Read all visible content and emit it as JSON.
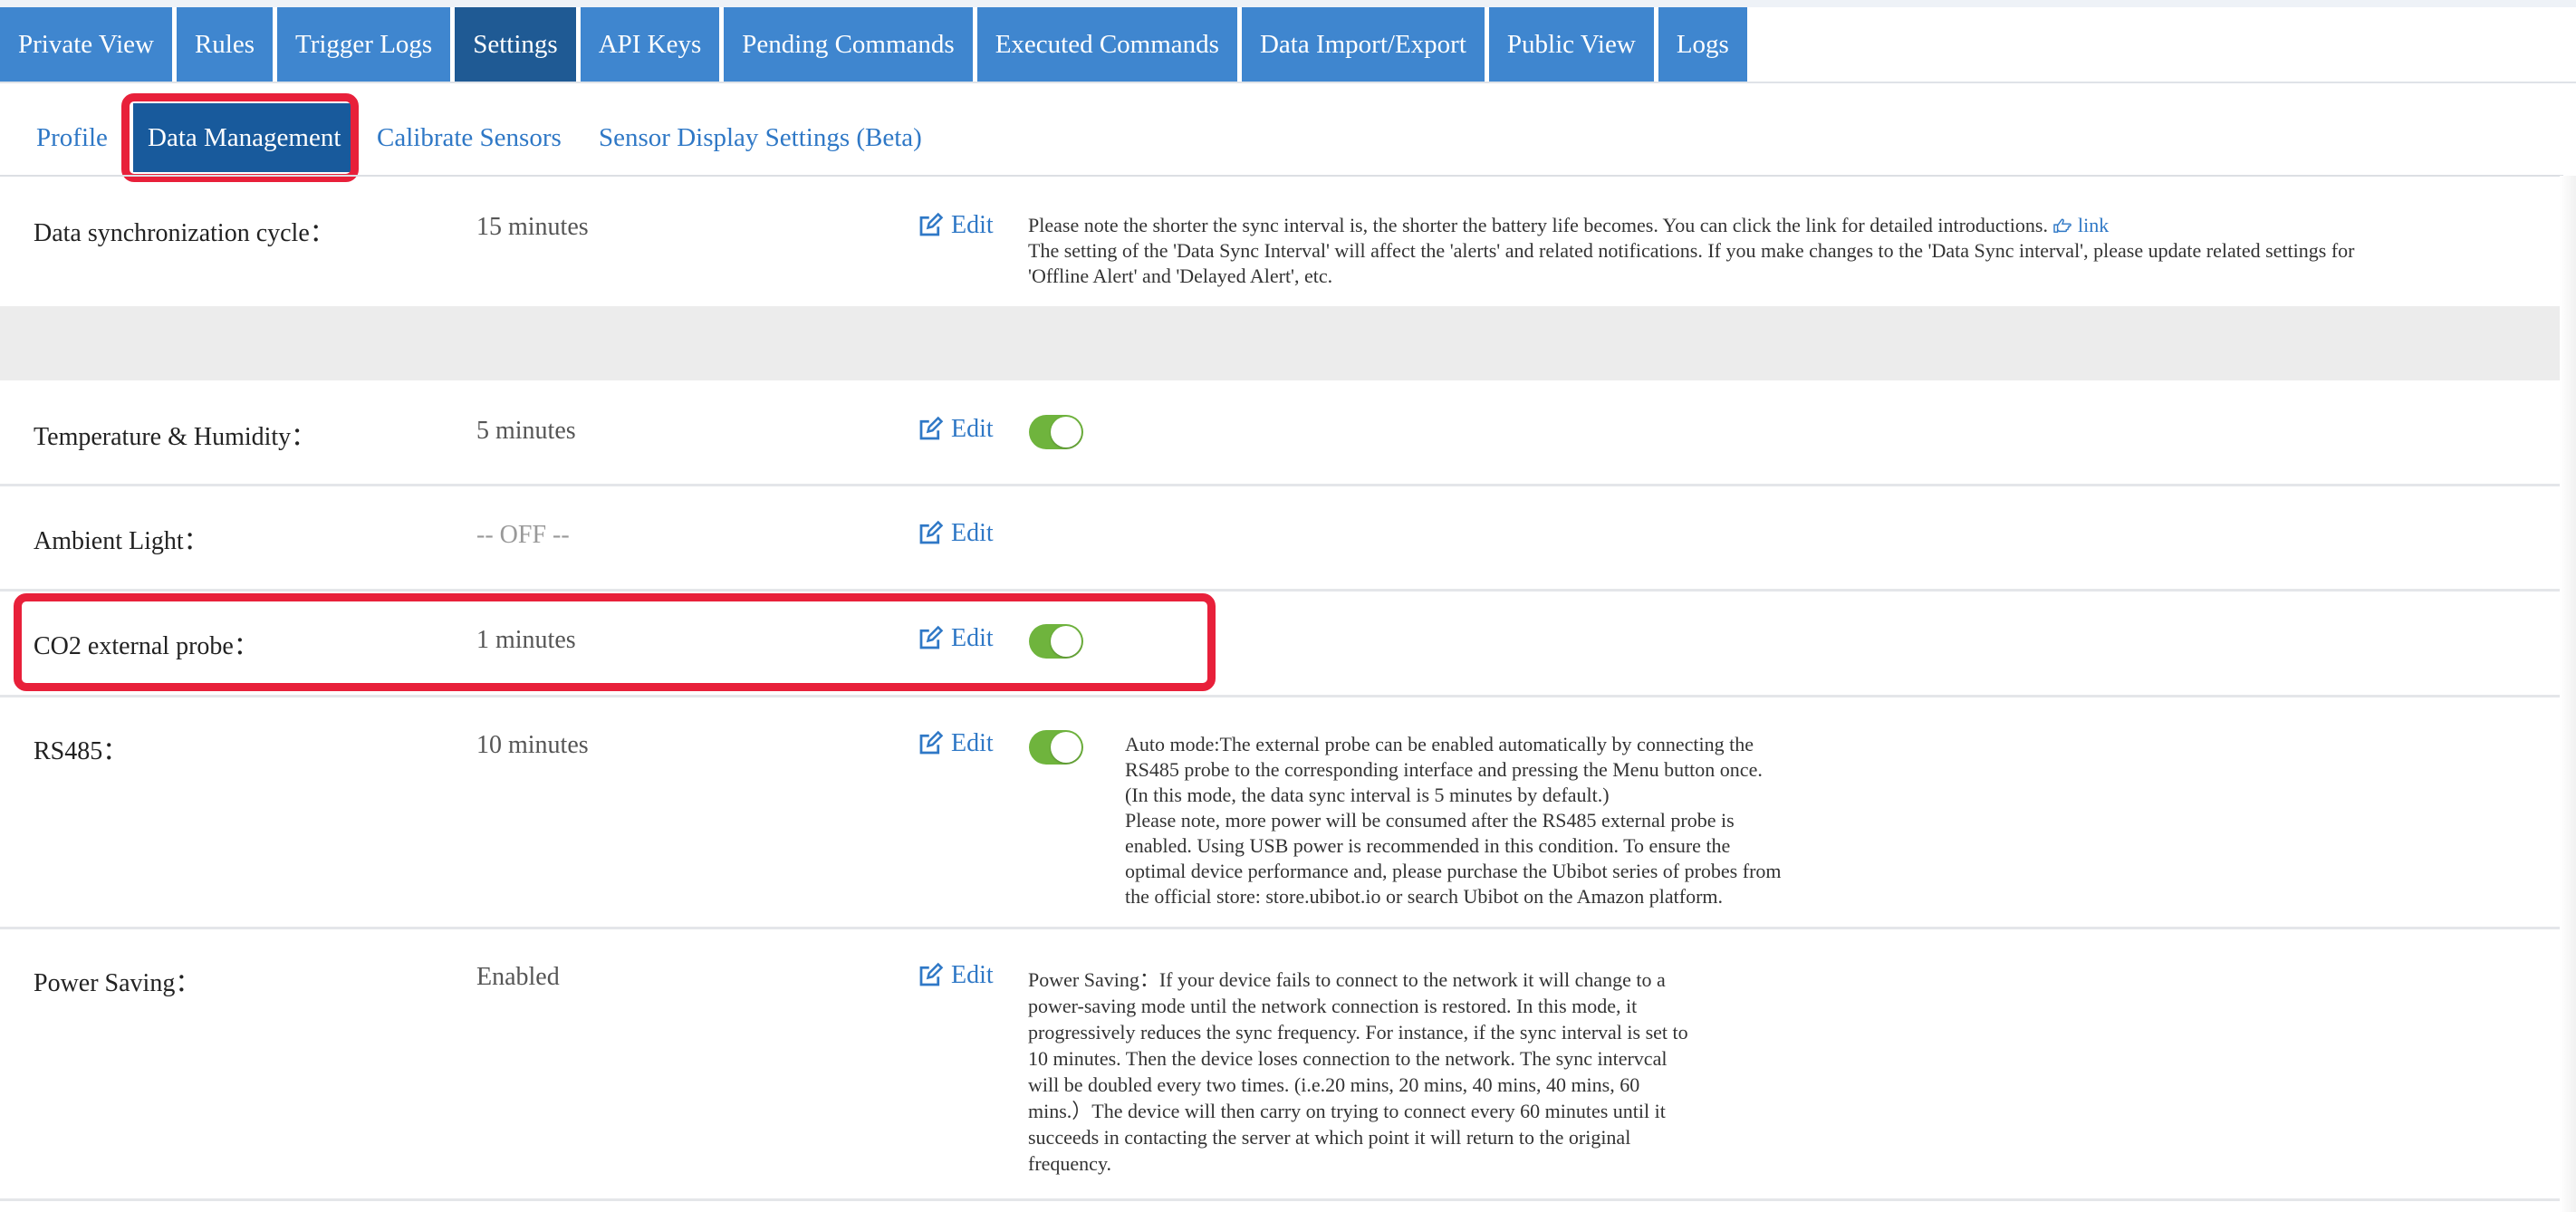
{
  "topnav": {
    "tabs": [
      {
        "label": "Private View"
      },
      {
        "label": "Rules"
      },
      {
        "label": "Trigger Logs"
      },
      {
        "label": "Settings",
        "active": true
      },
      {
        "label": "API Keys"
      },
      {
        "label": "Pending Commands"
      },
      {
        "label": "Executed Commands"
      },
      {
        "label": "Data Import/Export"
      },
      {
        "label": "Public View"
      },
      {
        "label": "Logs"
      }
    ]
  },
  "subnav": {
    "items": [
      {
        "label": "Profile"
      },
      {
        "label": "Data Management",
        "active": true
      },
      {
        "label": "Calibrate Sensors"
      },
      {
        "label": "Sensor Display Settings (Beta)"
      }
    ]
  },
  "edit_label": "Edit",
  "rows": {
    "sync": {
      "label": "Data synchronization cycle：",
      "value": "15 minutes",
      "note_line1": "Please note the shorter the sync interval is, the shorter the battery life becomes. You can click the link for detailed introductions.",
      "link_label": "link",
      "note_line2": "The setting of the 'Data Sync Interval' will affect the 'alerts' and related notifications. If you make changes to the 'Data Sync interval', please update related settings for",
      "note_line3": "'Offline Alert' and 'Delayed Alert', etc."
    },
    "temp": {
      "label": "Temperature & Humidity：",
      "value": "5 minutes",
      "toggle_on": true
    },
    "light": {
      "label": "Ambient Light：",
      "value": "-- OFF --"
    },
    "co2": {
      "label": "CO2 external probe：",
      "value": "1 minutes",
      "toggle_on": true
    },
    "rs485": {
      "label": "RS485：",
      "value": "10 minutes",
      "toggle_on": true,
      "note": [
        "Auto mode:The external probe can be enabled automatically by connecting the",
        "RS485 probe to the corresponding interface and pressing the Menu button once.",
        "(In this mode, the data sync interval is 5 minutes by default.)",
        "Please note, more power will be consumed after the RS485 external probe is",
        "enabled. Using USB power is recommended in this condition. To ensure the",
        "optimal device performance and, please purchase the Ubibot series of probes from",
        "the official store: store.ubibot.io or search Ubibot on the Amazon platform."
      ]
    },
    "power": {
      "label": "Power Saving：",
      "value": "Enabled",
      "note": [
        "Power Saving：If your device fails to connect to the network it will change to a",
        "power-saving mode until the network connection is restored. In this mode, it",
        "progressively reduces the sync frequency. For instance, if the sync interval is set to",
        "10 minutes. Then the device loses connection to the network. The sync intervcal",
        "will be doubled every two times. (i.e.20 mins, 20 mins, 40 mins, 40 mins, 60",
        "mins.）The device will then carry on trying to connect every 60 minutes until it",
        "succeeds in contacting the server at which point it will return to the original",
        "frequency."
      ]
    }
  },
  "colors": {
    "nav": "#3f86cf",
    "nav_active": "#1f5a94",
    "highlight": "#e8203a",
    "toggle": "#6fb43d",
    "link": "#2f78c6"
  }
}
